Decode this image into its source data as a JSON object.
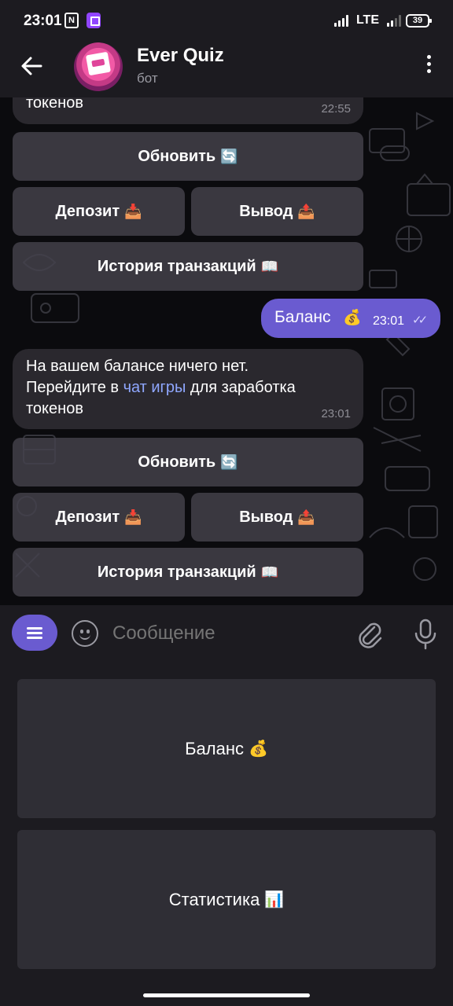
{
  "status_bar": {
    "time": "23:01",
    "nfc_label": "N",
    "network": "LTE",
    "battery": "39"
  },
  "header": {
    "title": "Ever Quiz",
    "subtitle": "бот"
  },
  "chat": {
    "msg1": {
      "text_tail": "токенов",
      "time": "22:55"
    },
    "kb1": {
      "refresh": "Обновить",
      "refresh_emoji": "🔄",
      "deposit": "Депозит",
      "deposit_emoji": "📥",
      "withdraw": "Вывод",
      "withdraw_emoji": "📤",
      "history": "История транзакций",
      "history_emoji": "📖"
    },
    "out1": {
      "text": "Баланс",
      "emoji": "💰",
      "time": "23:01",
      "status": "✓✓"
    },
    "msg2": {
      "line1": "На вашем балансе ничего нет.",
      "line2_pre": "Перейдите в ",
      "link": "чат игры",
      "line2_post": " для заработка",
      "line3": "токенов",
      "time": "23:01"
    },
    "kb2": {
      "refresh": "Обновить",
      "refresh_emoji": "🔄",
      "deposit": "Депозит",
      "deposit_emoji": "📥",
      "withdraw": "Вывод",
      "withdraw_emoji": "📤",
      "history": "История транзакций",
      "history_emoji": "📖"
    }
  },
  "input": {
    "placeholder": "Сообщение"
  },
  "keyboard": {
    "balance": "Баланс",
    "balance_emoji": "💰",
    "stats": "Статистика",
    "stats_emoji": "📊"
  },
  "colors": {
    "accent": "#6a5bd0",
    "bubble_in": "#2a282e",
    "link": "#8fa7ff",
    "bar": "#1c1b20"
  }
}
